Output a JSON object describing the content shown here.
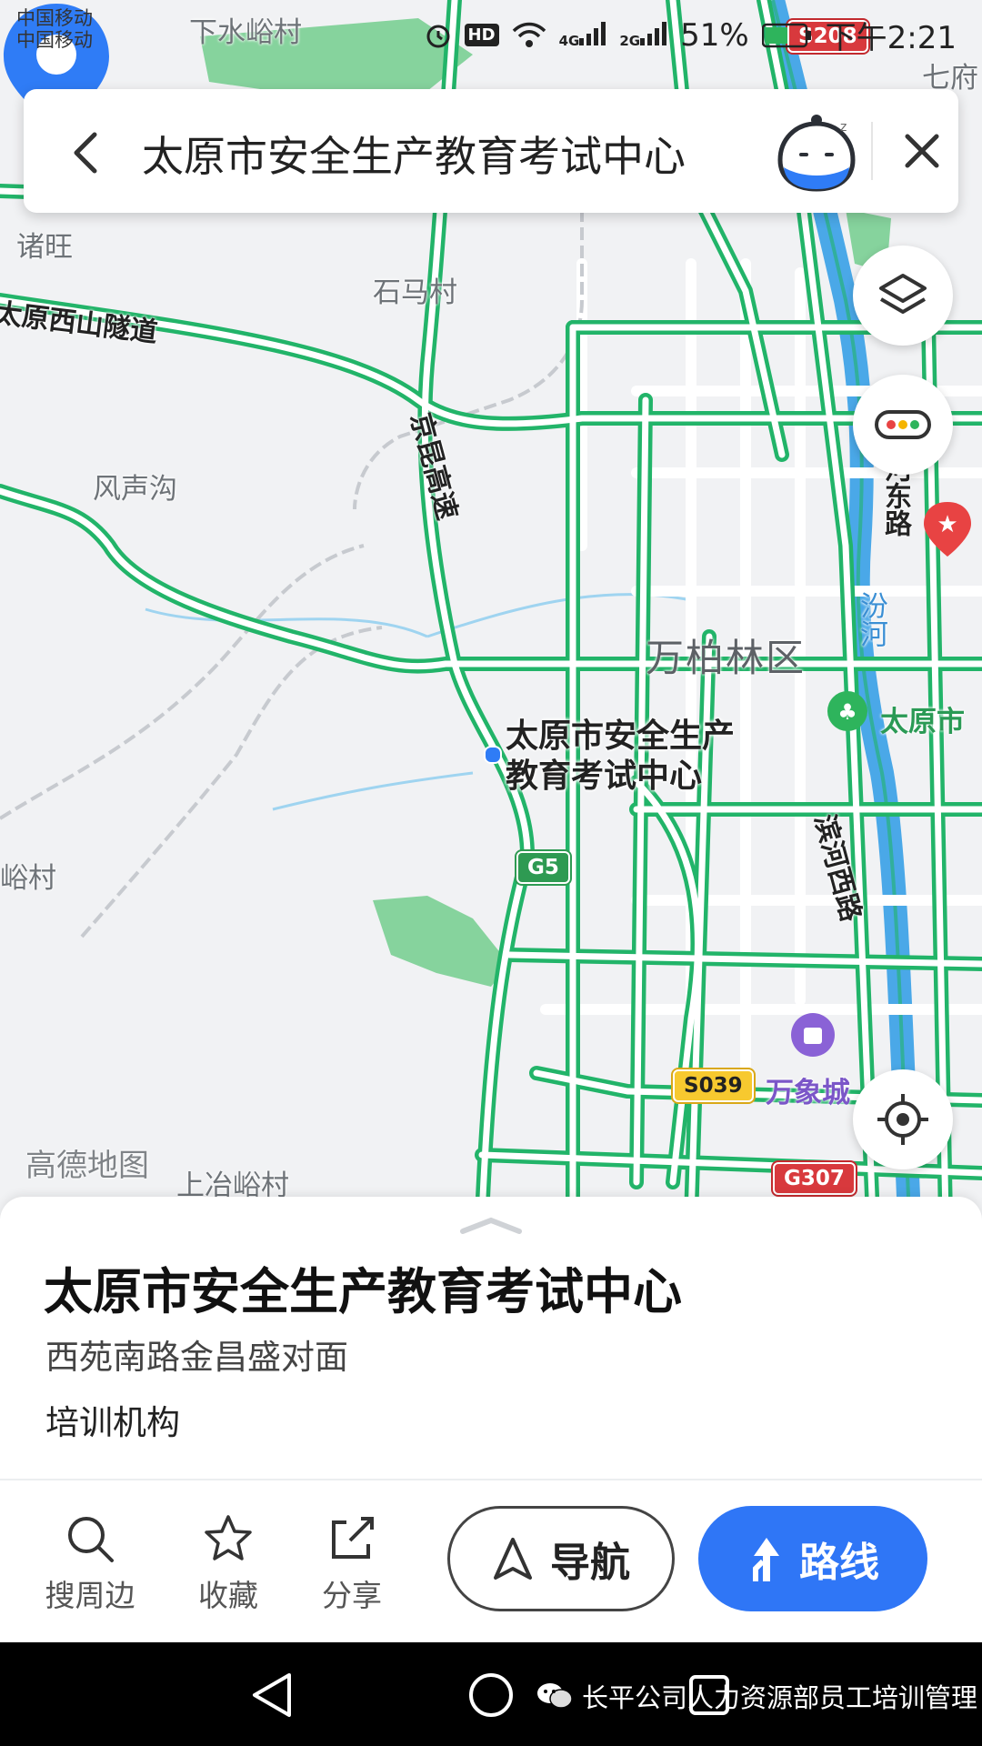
{
  "status_bar": {
    "carrier_1": "中国移动",
    "carrier_2": "中国移动",
    "signal_1": "4G",
    "signal_2": "2G",
    "battery": "51%",
    "time": "下午2:21"
  },
  "search": {
    "query": "太原市安全生产教育考试中心"
  },
  "map": {
    "labels": {
      "xiashuiyu": "下水峪村",
      "qifu": "七府",
      "zhuwang": "诸旺",
      "shima": "石马村",
      "xishan_tunnel": "太原西山隧道",
      "jingkun_expressway": "京昆高速",
      "fengshenggou": "风声沟",
      "district": "万柏林区",
      "hedong_road": "河东路",
      "fenhe": "汾河",
      "park": "太原市",
      "yucun": "峪村",
      "binhe_west": "滨河西路",
      "wanxiang": "万象城",
      "watermark": "高德地图",
      "shangyeyu": "上冶峪村"
    },
    "shields": {
      "g5": "G5",
      "s039": "S039",
      "g307": "G307",
      "s208": "S208"
    },
    "poi_label_line1": "太原市安全生产",
    "poi_label_line2": "教育考试中心",
    "route_color": "#22b469",
    "pin_color": "#2f7cf6"
  },
  "place": {
    "name": "太原市安全生产教育考试中心",
    "address": "西苑南路金昌盛对面",
    "category": "培训机构"
  },
  "actions": {
    "nearby": "搜周边",
    "favorite": "收藏",
    "share": "分享",
    "navigate": "导航",
    "route": "路线"
  },
  "wechat_watermark": "长平公司人力资源部员工培训管理"
}
